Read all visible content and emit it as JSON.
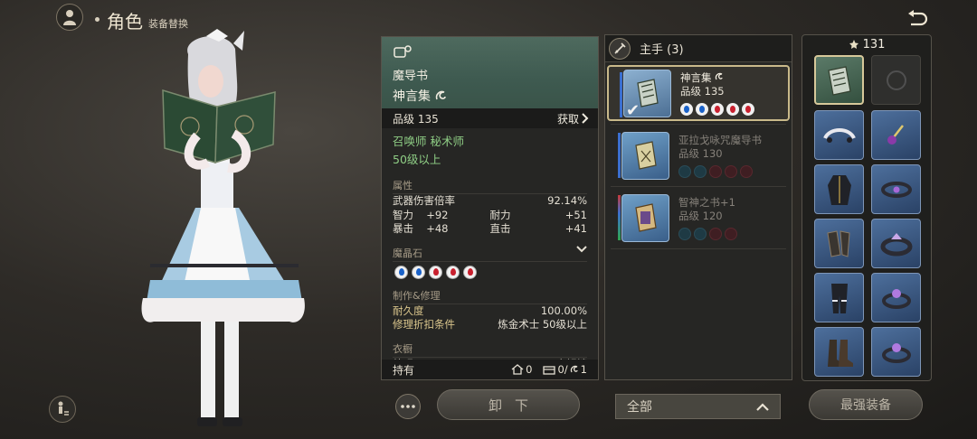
{
  "header": {
    "title": "角色",
    "subtitle": "装备替换"
  },
  "detail": {
    "type_name": "魔导书",
    "item_name": "神言集",
    "item_level": "品级 135",
    "acquire_label": "获取",
    "jobs": "召唤师 秘术师",
    "level_req": "50级以上",
    "sections": {
      "attributes": "属性",
      "materia": "魔晶石",
      "crafting": "制作&修理",
      "wardrobe": "衣橱"
    },
    "stats": {
      "weapon_dmg_label": "武器伤害倍率",
      "weapon_dmg_value": "92.14%",
      "int_label": "智力",
      "int_value": "+92",
      "vit_label": "耐力",
      "vit_value": "+51",
      "crit_label": "暴击",
      "crit_value": "+48",
      "dh_label": "直击",
      "dh_value": "+41"
    },
    "materia_colors": [
      "blue",
      "blue",
      "red",
      "red",
      "red"
    ],
    "durability_label": "耐久度",
    "durability_value": "100.00%",
    "repair_label": "修理折扣条件",
    "repair_value": "炼金术士 50级以上",
    "wardrobe_left": "外观",
    "wardrobe_right": "未解锁",
    "owned_label": "持有",
    "house_count": "0",
    "chest_count": "0/",
    "glam_count": "1"
  },
  "list": {
    "header": "主手 (3)",
    "items": [
      {
        "name": "神言集",
        "level": "品级 135",
        "state": "selected",
        "materia": [
          "b",
          "b",
          "r",
          "r",
          "r"
        ]
      },
      {
        "name": "亚拉戈咏咒魔导书",
        "level": "品级 130",
        "state": "dim",
        "materia": [
          "db",
          "db",
          "dr",
          "dr",
          "dr"
        ]
      },
      {
        "name": "智神之书+1",
        "level": "品级 120",
        "state": "dim",
        "materia": [
          "db",
          "db",
          "dr",
          "dr"
        ]
      }
    ]
  },
  "gear": {
    "item_level": "131"
  },
  "buttons": {
    "unequip": "卸下",
    "filter": "全部",
    "best": "最强装备"
  },
  "colors": {
    "accent_gold": "#c9b98a",
    "job_green": "#8fce85",
    "panel_bg": "#262624"
  }
}
